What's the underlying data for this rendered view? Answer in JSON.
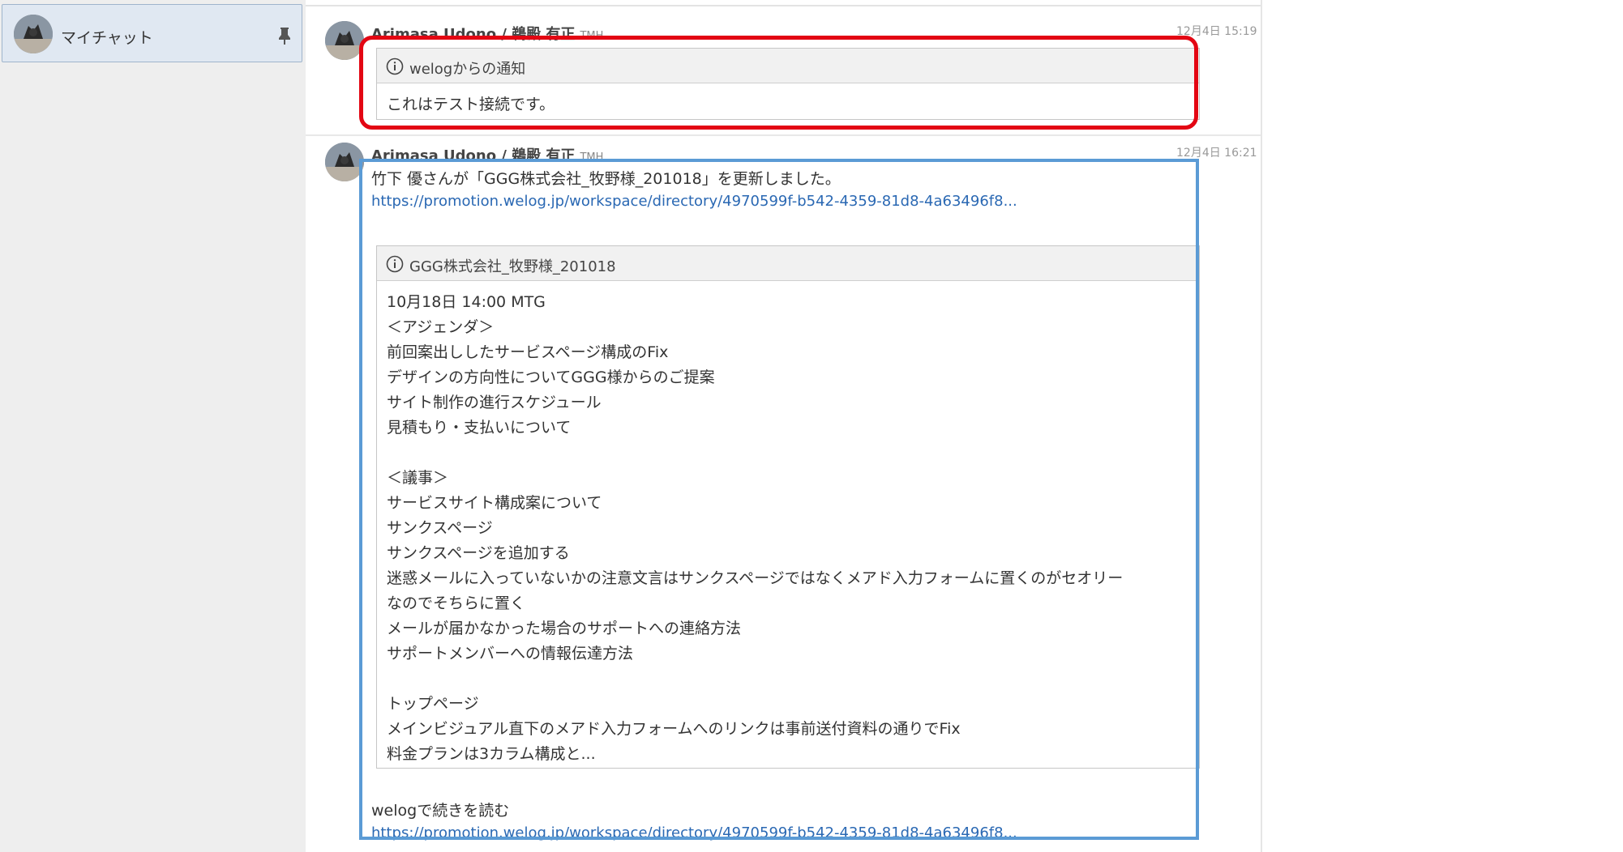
{
  "sidebar": {
    "chat_item": {
      "label": "マイチャット",
      "pin_icon": "pin-icon",
      "avatar": "avatar"
    }
  },
  "messages": [
    {
      "sender": "Arimasa Udono / 鵜殿 有正",
      "sender_suffix": "TMH",
      "timestamp": "12月4日 15:19",
      "card": {
        "icon": "info-icon",
        "title": "welogからの通知",
        "body": "これはテスト接続です。"
      }
    },
    {
      "sender": "Arimasa Udono / 鵜殿 有正",
      "sender_suffix": "TMH",
      "timestamp": "12月4日 16:21",
      "text": "竹下 優さんが「GGG株式会社_牧野様_201018」を更新しました。",
      "link": "https://promotion.welog.jp/workspace/directory/4970599f-b542-4359-81d8-4a63496f8...",
      "card": {
        "icon": "info-icon",
        "title": "GGG株式会社_牧野様_201018",
        "lines": [
          "10月18日 14:00 MTG",
          "＜アジェンダ＞",
          "前回案出ししたサービスページ構成のFix",
          "デザインの方向性についてGGG様からのご提案",
          "サイト制作の進行スケジュール",
          "見積もり・支払いについて",
          "",
          "＜議事＞",
          "サービスサイト構成案について",
          "サンクスページ",
          "サンクスページを追加する",
          "迷惑メールに入っていないかの注意文言はサンクスページではなくメアド入力フォームに置くのがセオリー",
          "なのでそちらに置く",
          "メールが届かなかった場合のサポートへの連絡方法",
          "サポートメンバーへの情報伝達方法",
          "",
          "トップページ",
          "メインビジュアル直下のメアド入力フォームへのリンクは事前送付資料の通りでFix",
          "料金プランは3カラム構成と..."
        ]
      },
      "read_more": "welogで続きを読む",
      "read_more_link": "https://promotion.welog.jp/workspace/directory/4970599f-b542-4359-81d8-4a63496f8..."
    }
  ],
  "colors": {
    "highlight_red": "#e30613",
    "highlight_blue": "#5b9bd5",
    "link": "#2a68b3",
    "sidebar_bg": "#eeeeee",
    "selected_item_bg": "#e0e8f2"
  }
}
